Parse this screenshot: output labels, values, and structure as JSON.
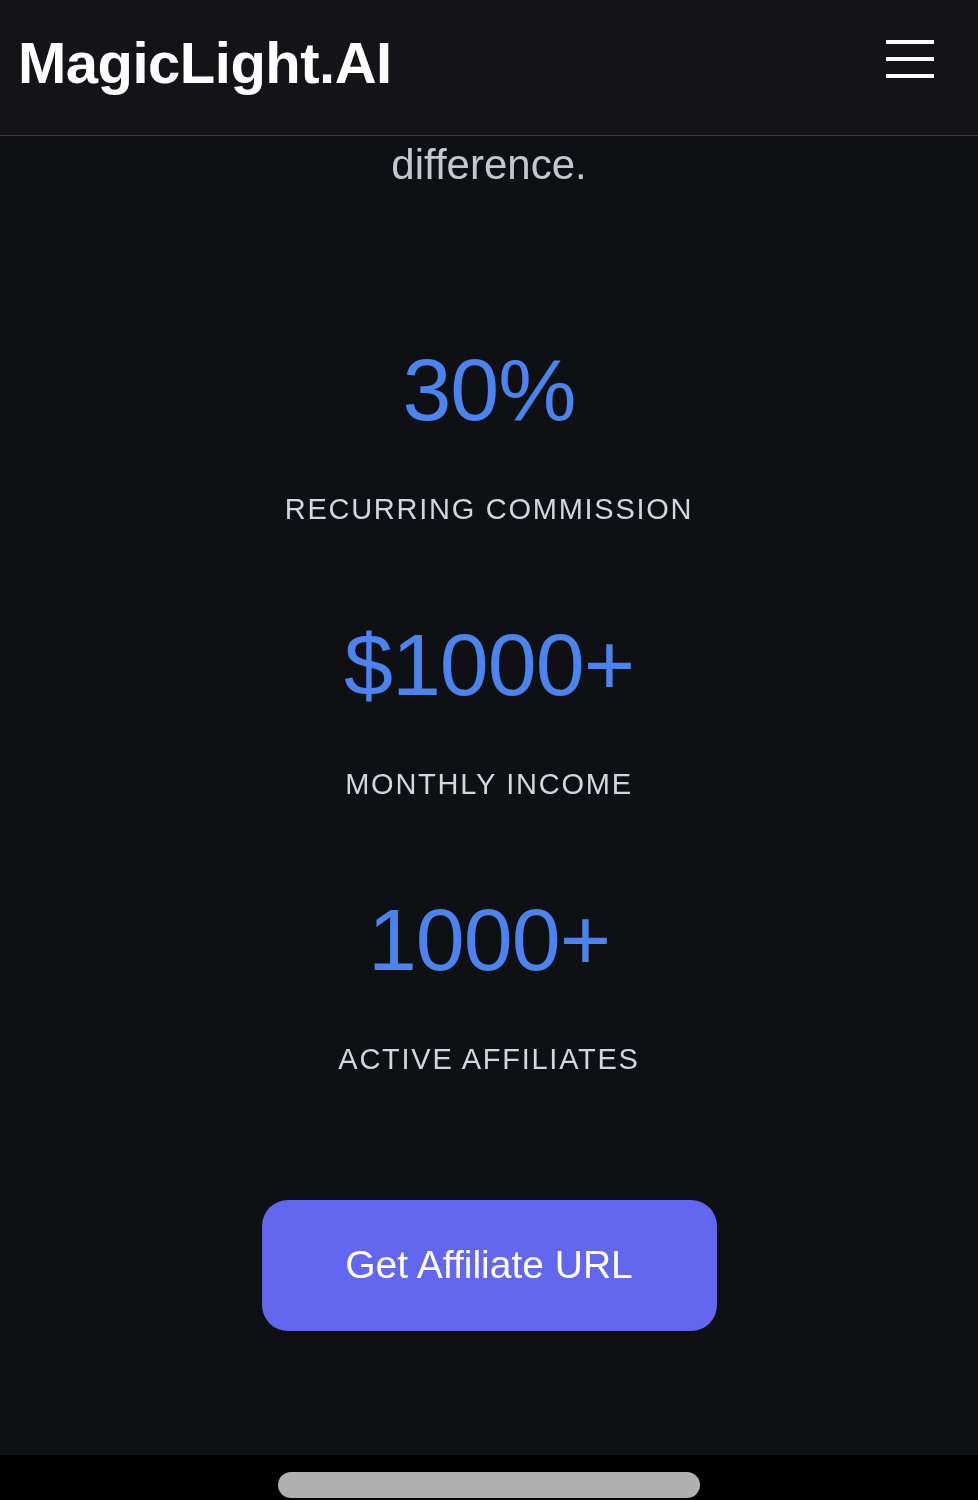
{
  "header": {
    "logo": "MagicLight.AI"
  },
  "intro": {
    "text": "difference."
  },
  "stats": [
    {
      "value": "30%",
      "label": "RECURRING COMMISSION"
    },
    {
      "value": "$1000+",
      "label": "MONTHLY INCOME"
    },
    {
      "value": "1000+",
      "label": "ACTIVE AFFILIATES"
    }
  ],
  "cta": {
    "label": "Get Affiliate URL"
  }
}
